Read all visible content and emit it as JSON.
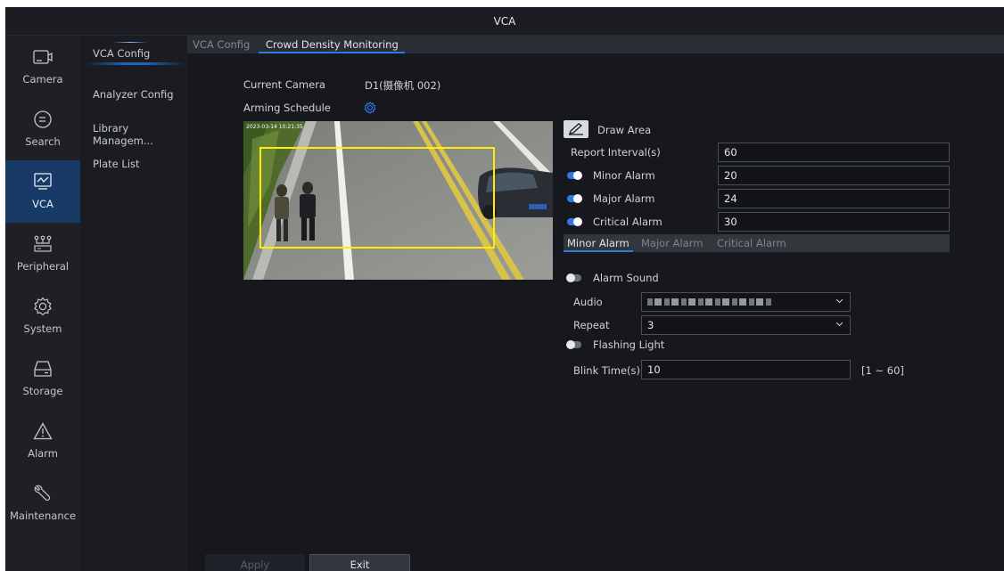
{
  "window": {
    "title": "VCA"
  },
  "nav": [
    {
      "label": "Camera",
      "icon": "camera-icon",
      "active": false
    },
    {
      "label": "Search",
      "icon": "search-icon",
      "active": false
    },
    {
      "label": "VCA",
      "icon": "vca-icon",
      "active": true
    },
    {
      "label": "Peripheral",
      "icon": "peripheral-icon",
      "active": false
    },
    {
      "label": "System",
      "icon": "system-icon",
      "active": false
    },
    {
      "label": "Storage",
      "icon": "storage-icon",
      "active": false
    },
    {
      "label": "Alarm",
      "icon": "alarm-icon",
      "active": false
    },
    {
      "label": "Maintenance",
      "icon": "maintenance-icon",
      "active": false
    }
  ],
  "submenu": [
    {
      "label": "VCA Config",
      "active": true
    },
    {
      "label": "Analyzer Config",
      "active": false
    },
    {
      "label": "Library Managem...",
      "active": false
    },
    {
      "label": "Plate List",
      "active": false
    }
  ],
  "tabs": [
    {
      "label": "VCA Config",
      "active": false
    },
    {
      "label": "Crowd Density Monitoring",
      "active": true
    }
  ],
  "camera": {
    "label": "Current Camera",
    "value": "D1(摄像机 002)"
  },
  "arming": {
    "label": "Arming Schedule"
  },
  "preview": {
    "timestamp": "2023-03-14 10:21:35"
  },
  "draw_area": {
    "label": "Draw Area"
  },
  "report_interval": {
    "label": "Report Interval(s)",
    "value": "60"
  },
  "alarms": [
    {
      "label": "Minor Alarm",
      "value": "20",
      "enabled": true
    },
    {
      "label": "Major Alarm",
      "value": "24",
      "enabled": true
    },
    {
      "label": "Critical Alarm",
      "value": "30",
      "enabled": true
    }
  ],
  "alarm_tabs": [
    {
      "label": "Minor Alarm",
      "active": true
    },
    {
      "label": "Major Alarm",
      "active": false
    },
    {
      "label": "Critical Alarm",
      "active": false
    }
  ],
  "alarm_sound": {
    "label": "Alarm Sound",
    "enabled": false
  },
  "audio": {
    "label": "Audio",
    "value": ""
  },
  "repeat": {
    "label": "Repeat",
    "value": "3"
  },
  "flashing_light": {
    "label": "Flashing Light",
    "enabled": false
  },
  "blink_time": {
    "label": "Blink Time(s)",
    "value": "10",
    "range": "[1 ~ 60]"
  },
  "buttons": {
    "apply": "Apply",
    "exit": "Exit"
  },
  "colors": {
    "accent": "#2d7ae0",
    "active_nav": "#173a66",
    "region": "#ffee00"
  }
}
